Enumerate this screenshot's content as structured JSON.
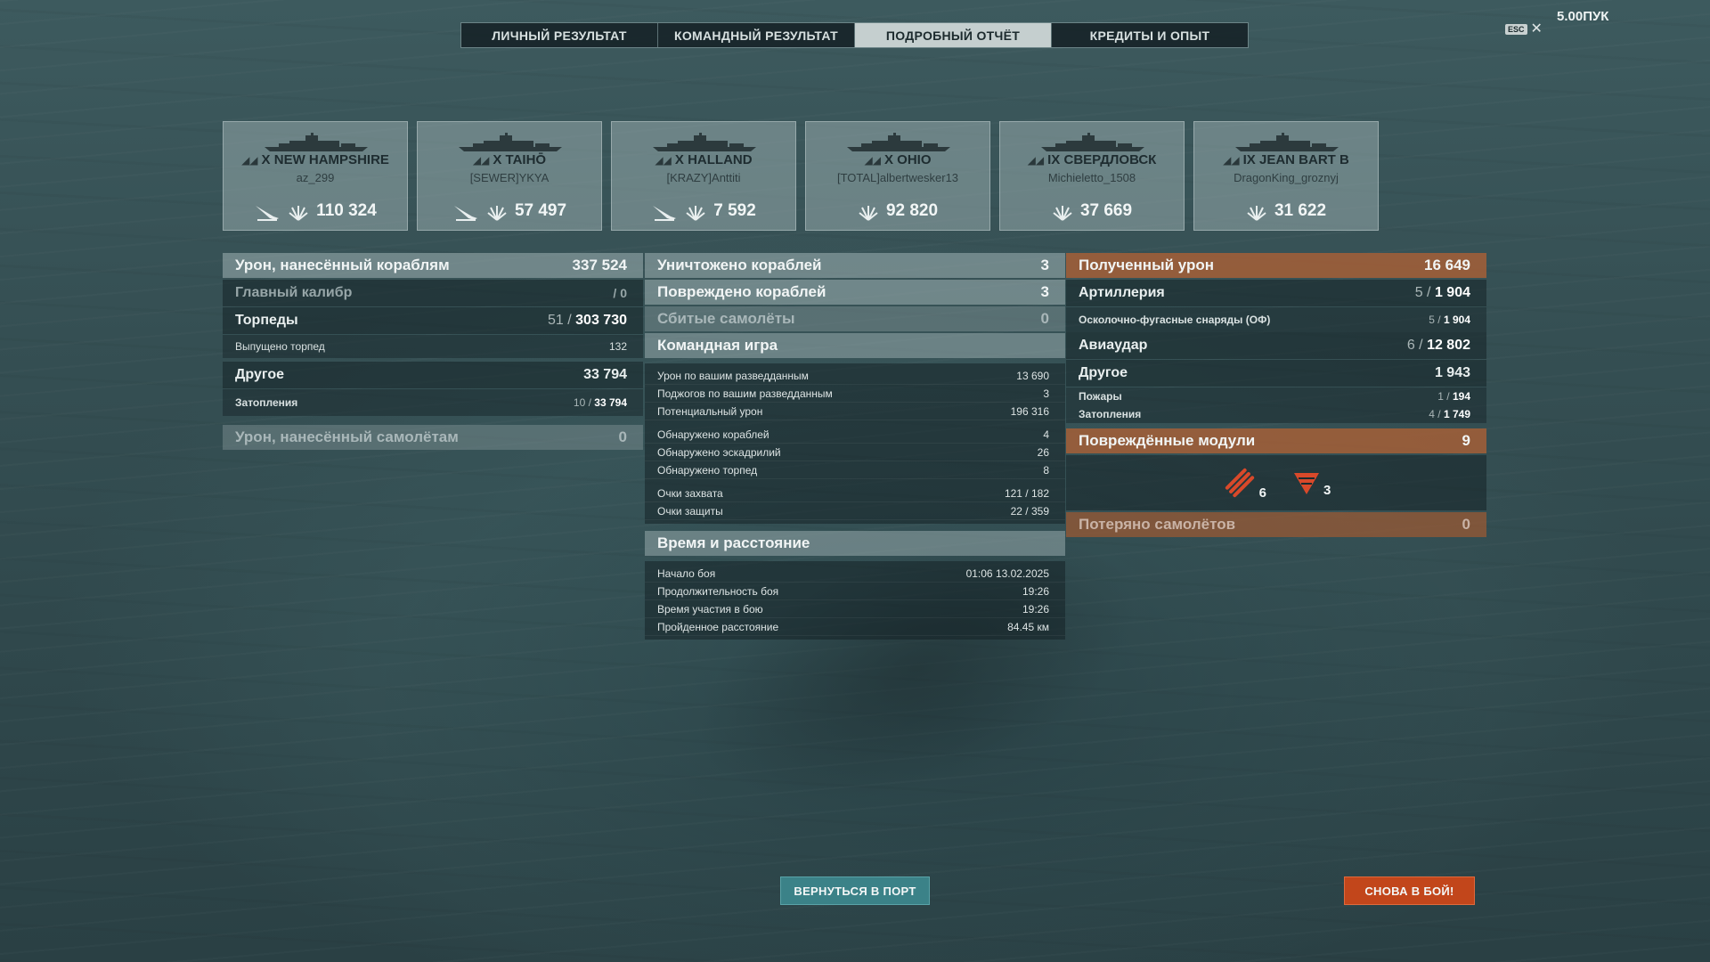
{
  "tabs": [
    {
      "label": "ЛИЧНЫЙ РЕЗУЛЬТАТ",
      "active": false
    },
    {
      "label": "КОМАНДНЫЙ РЕЗУЛЬТАТ",
      "active": false
    },
    {
      "label": "ПОДРОБНЫЙ ОТЧЁТ",
      "active": true
    },
    {
      "label": "КРЕДИТЫ И ОПЫТ",
      "active": false
    }
  ],
  "header": {
    "esc": "ESC",
    "close": "✕",
    "top_right": "5.00ПУК"
  },
  "cards": [
    {
      "tier": "X",
      "ship": "NEW HAMPSHIRE",
      "player": "az_299",
      "score": "110 324",
      "torpedo_icon": true
    },
    {
      "tier": "X",
      "ship": "TAIHŌ",
      "player": "[SEWER]YKYA",
      "score": "57 497",
      "torpedo_icon": true
    },
    {
      "tier": "X",
      "ship": "HALLAND",
      "player": "[KRAZY]Anttiti",
      "score": "7 592",
      "torpedo_icon": true
    },
    {
      "tier": "X",
      "ship": "OHIO",
      "player": "[TOTAL]albertwesker13",
      "score": "92 820",
      "torpedo_icon": false
    },
    {
      "tier": "IX",
      "ship": "СВЕРДЛОВСК",
      "player": "Michieletto_1508",
      "score": "37 669",
      "torpedo_icon": false
    },
    {
      "tier": "IX",
      "ship": "JEAN BART B",
      "player": "DragonKing_groznyj",
      "score": "31 622",
      "torpedo_icon": false
    }
  ],
  "left": {
    "damage_ships": {
      "label": "Урон, нанесённый кораблям",
      "value": "337 524"
    },
    "main_battery": {
      "label": "Главный калибр",
      "value": "/ 0"
    },
    "torpedoes": {
      "label": "Торпеды",
      "hits": "51",
      "value": "303 730"
    },
    "torpedoes_fired": {
      "label": "Выпущено торпед",
      "value": "132"
    },
    "other": {
      "label": "Другое",
      "value": "33 794"
    },
    "flooding": {
      "label": "Затопления",
      "hits": "10",
      "value": "33 794"
    },
    "damage_planes": {
      "label": "Урон, нанесённый самолётам",
      "value": "0"
    }
  },
  "middle": {
    "destroyed": {
      "label": "Уничтожено кораблей",
      "value": "3"
    },
    "damaged": {
      "label": "Повреждено кораблей",
      "value": "3"
    },
    "planes": {
      "label": "Сбитые самолёты",
      "value": "0"
    },
    "team_play": {
      "title": "Командная игра",
      "group1": [
        {
          "label": "Урон по вашим разведданным",
          "value": "13 690"
        },
        {
          "label": "Поджогов по вашим разведданным",
          "value": "3"
        },
        {
          "label": "Потенциальный урон",
          "value": "196 316"
        }
      ],
      "group2": [
        {
          "label": "Обнаружено кораблей",
          "value": "4"
        },
        {
          "label": "Обнаружено эскадрилий",
          "value": "26"
        },
        {
          "label": "Обнаружено торпед",
          "value": "8"
        }
      ],
      "group3": [
        {
          "label": "Очки захвата",
          "value": "121 / 182"
        },
        {
          "label": "Очки защиты",
          "value": "22 / 359"
        }
      ]
    },
    "time": {
      "title": "Время и расстояние",
      "items": [
        {
          "label": "Начало боя",
          "value": "01:06  13.02.2025"
        },
        {
          "label": "Продолжительность боя",
          "value": "19:26"
        },
        {
          "label": "Время участия в бою",
          "value": "19:26"
        },
        {
          "label": "Пройденное расстояние",
          "value": "84.45 км"
        }
      ]
    }
  },
  "right": {
    "received": {
      "label": "Полученный урон",
      "value": "16 649"
    },
    "artillery": {
      "label": "Артиллерия",
      "hits": "5",
      "value": "1 904"
    },
    "he_shells": {
      "label": "Осколочно-фугасные снаряды (ОФ)",
      "hits": "5",
      "value": "1 904"
    },
    "air_strike": {
      "label": "Авиаудар",
      "hits": "6",
      "value": "12 802"
    },
    "other": {
      "label": "Другое",
      "value": "1 943"
    },
    "fires": {
      "label": "Пожары",
      "hits": "1",
      "value": "194"
    },
    "flooding": {
      "label": "Затопления",
      "hits": "4",
      "value": "1 749"
    },
    "modules": {
      "label": "Повреждённые модули",
      "value": "9"
    },
    "module_items": [
      {
        "icon": "torpedo-tubes-icon",
        "count": "6"
      },
      {
        "icon": "steering-gear-icon",
        "count": "3"
      }
    ],
    "planes_lost": {
      "label": "Потеряно самолётов",
      "value": "0"
    }
  },
  "buttons": {
    "port": "ВЕРНУТЬСЯ В ПОРТ",
    "battle": "СНОВА В БОЙ!"
  },
  "colors": {
    "accent_orange": "#c2461b",
    "teal_button": "#3b8288",
    "active_tab": "#c5cfcf"
  }
}
